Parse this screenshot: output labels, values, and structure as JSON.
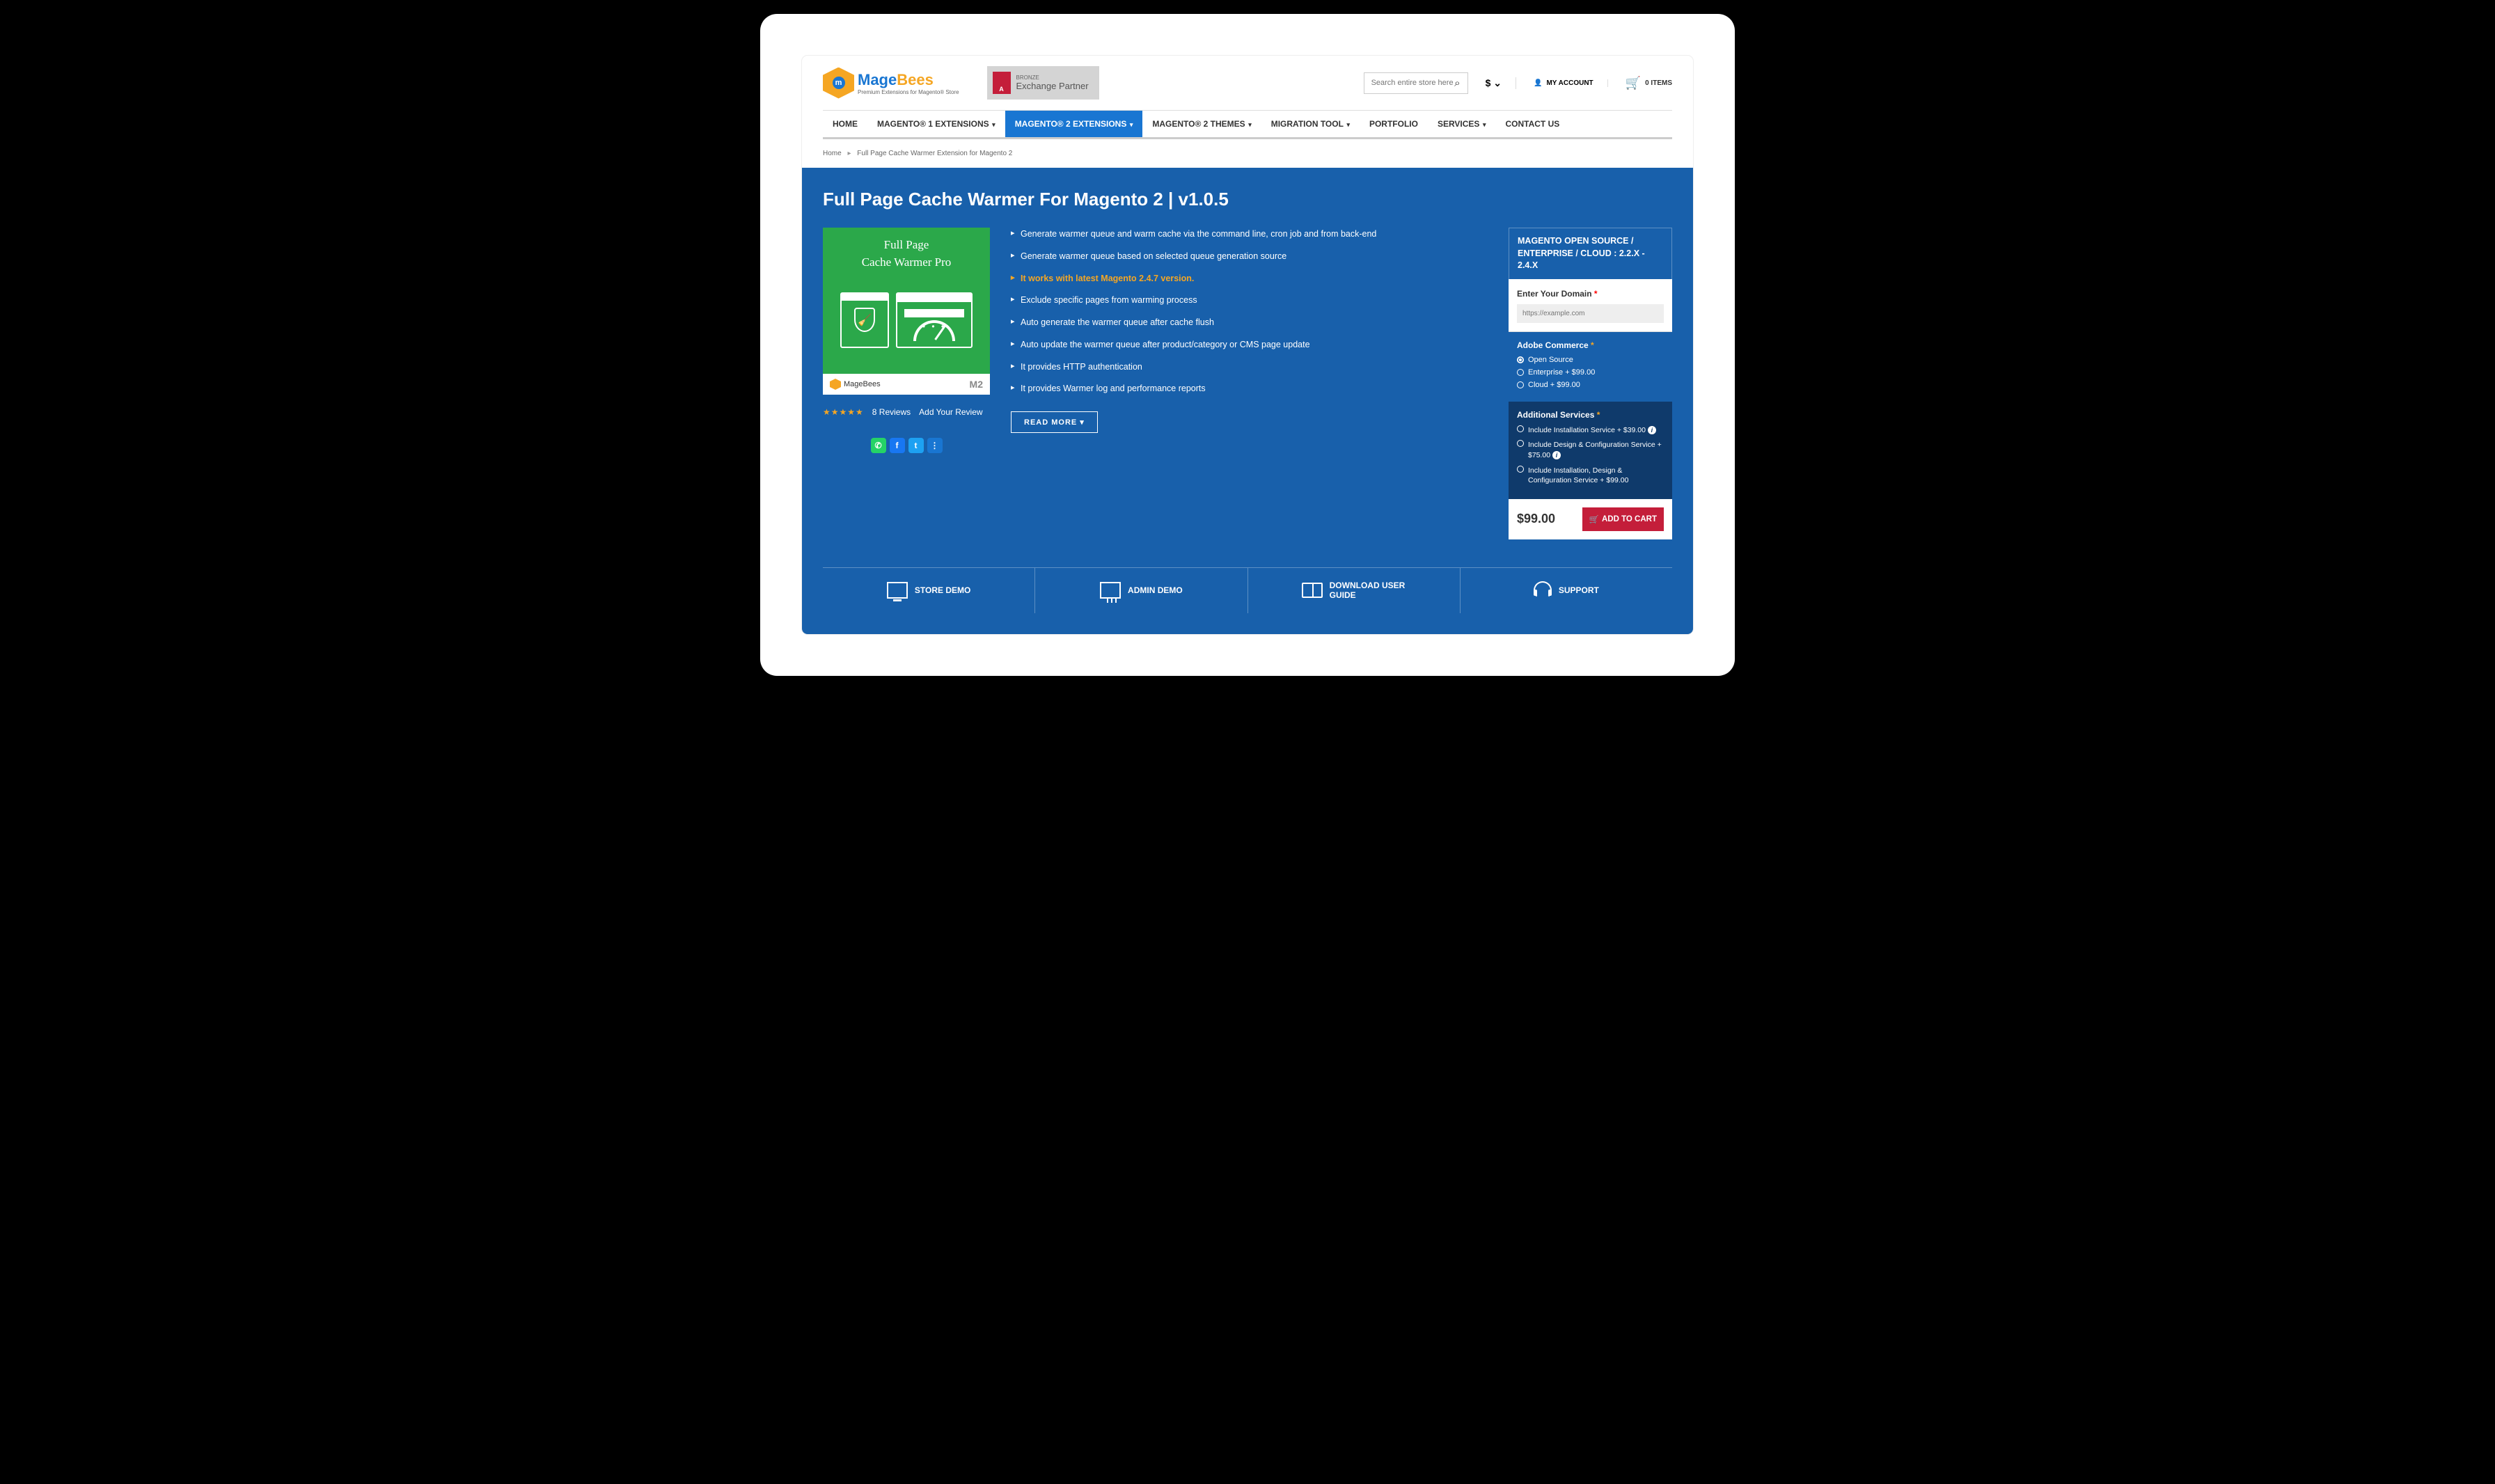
{
  "header": {
    "brand_mage": "Mage",
    "brand_bees": "Bees",
    "brand_sub": "Premium Extensions for Magento® Store",
    "partner_top": "BRONZE",
    "partner_main": "Exchange Partner",
    "search_placeholder": "Search entire store here",
    "currency": "$",
    "account": "MY ACCOUNT",
    "cart": "0 ITEMS"
  },
  "nav": {
    "home": "HOME",
    "m1": "MAGENTO® 1 EXTENSIONS",
    "m2ext": "MAGENTO® 2 EXTENSIONS",
    "m2themes": "MAGENTO® 2 THEMES",
    "migration": "MIGRATION TOOL",
    "portfolio": "PORTFOLIO",
    "services": "SERVICES",
    "contact": "CONTACT US"
  },
  "breadcrumb": {
    "home": "Home",
    "current": "Full Page Cache Warmer Extension for Magento 2"
  },
  "title": "Full Page Cache Warmer For Magento 2  |  v1.0.5",
  "product_img": {
    "line1": "Full Page",
    "line2": "Cache Warmer Pro",
    "footer_brand": "MageBees",
    "m2": "M2"
  },
  "reviews": {
    "count_label": "8   Reviews",
    "add": "Add Your Review"
  },
  "features": [
    "Generate warmer queue and warm cache via the command line, cron job and from back-end",
    "Generate warmer queue based on selected queue generation source",
    "It works with latest Magento 2.4.7 version.",
    "Exclude specific pages from warming process",
    "Auto generate the warmer queue after cache flush",
    "Auto update the warmer queue after product/category or CMS page update",
    "It provides HTTP authentication",
    "It provides Warmer log and performance reports"
  ],
  "read_more": "READ MORE ▾",
  "purchase": {
    "header": "MAGENTO OPEN SOURCE / ENTERPRISE / CLOUD : 2.2.X - 2.4.X",
    "domain_label": "Enter Your Domain",
    "domain_placeholder": "https://example.com",
    "commerce_title": "Adobe Commerce",
    "opt_open": "Open Source",
    "opt_ent": "Enterprise + $99.00",
    "opt_cloud": "Cloud + $99.00",
    "services_title": "Additional Services",
    "svc1": "Include Installation Service + $39.00",
    "svc2": "Include Design & Configuration Service + $75.00",
    "svc3": "Include Installation, Design & Configuration Service + $99.00",
    "price": "$99.00",
    "add_cart": "ADD TO CART"
  },
  "bottom": {
    "store": "STORE DEMO",
    "admin": "ADMIN DEMO",
    "guide": "DOWNLOAD USER GUIDE",
    "support": "SUPPORT"
  }
}
